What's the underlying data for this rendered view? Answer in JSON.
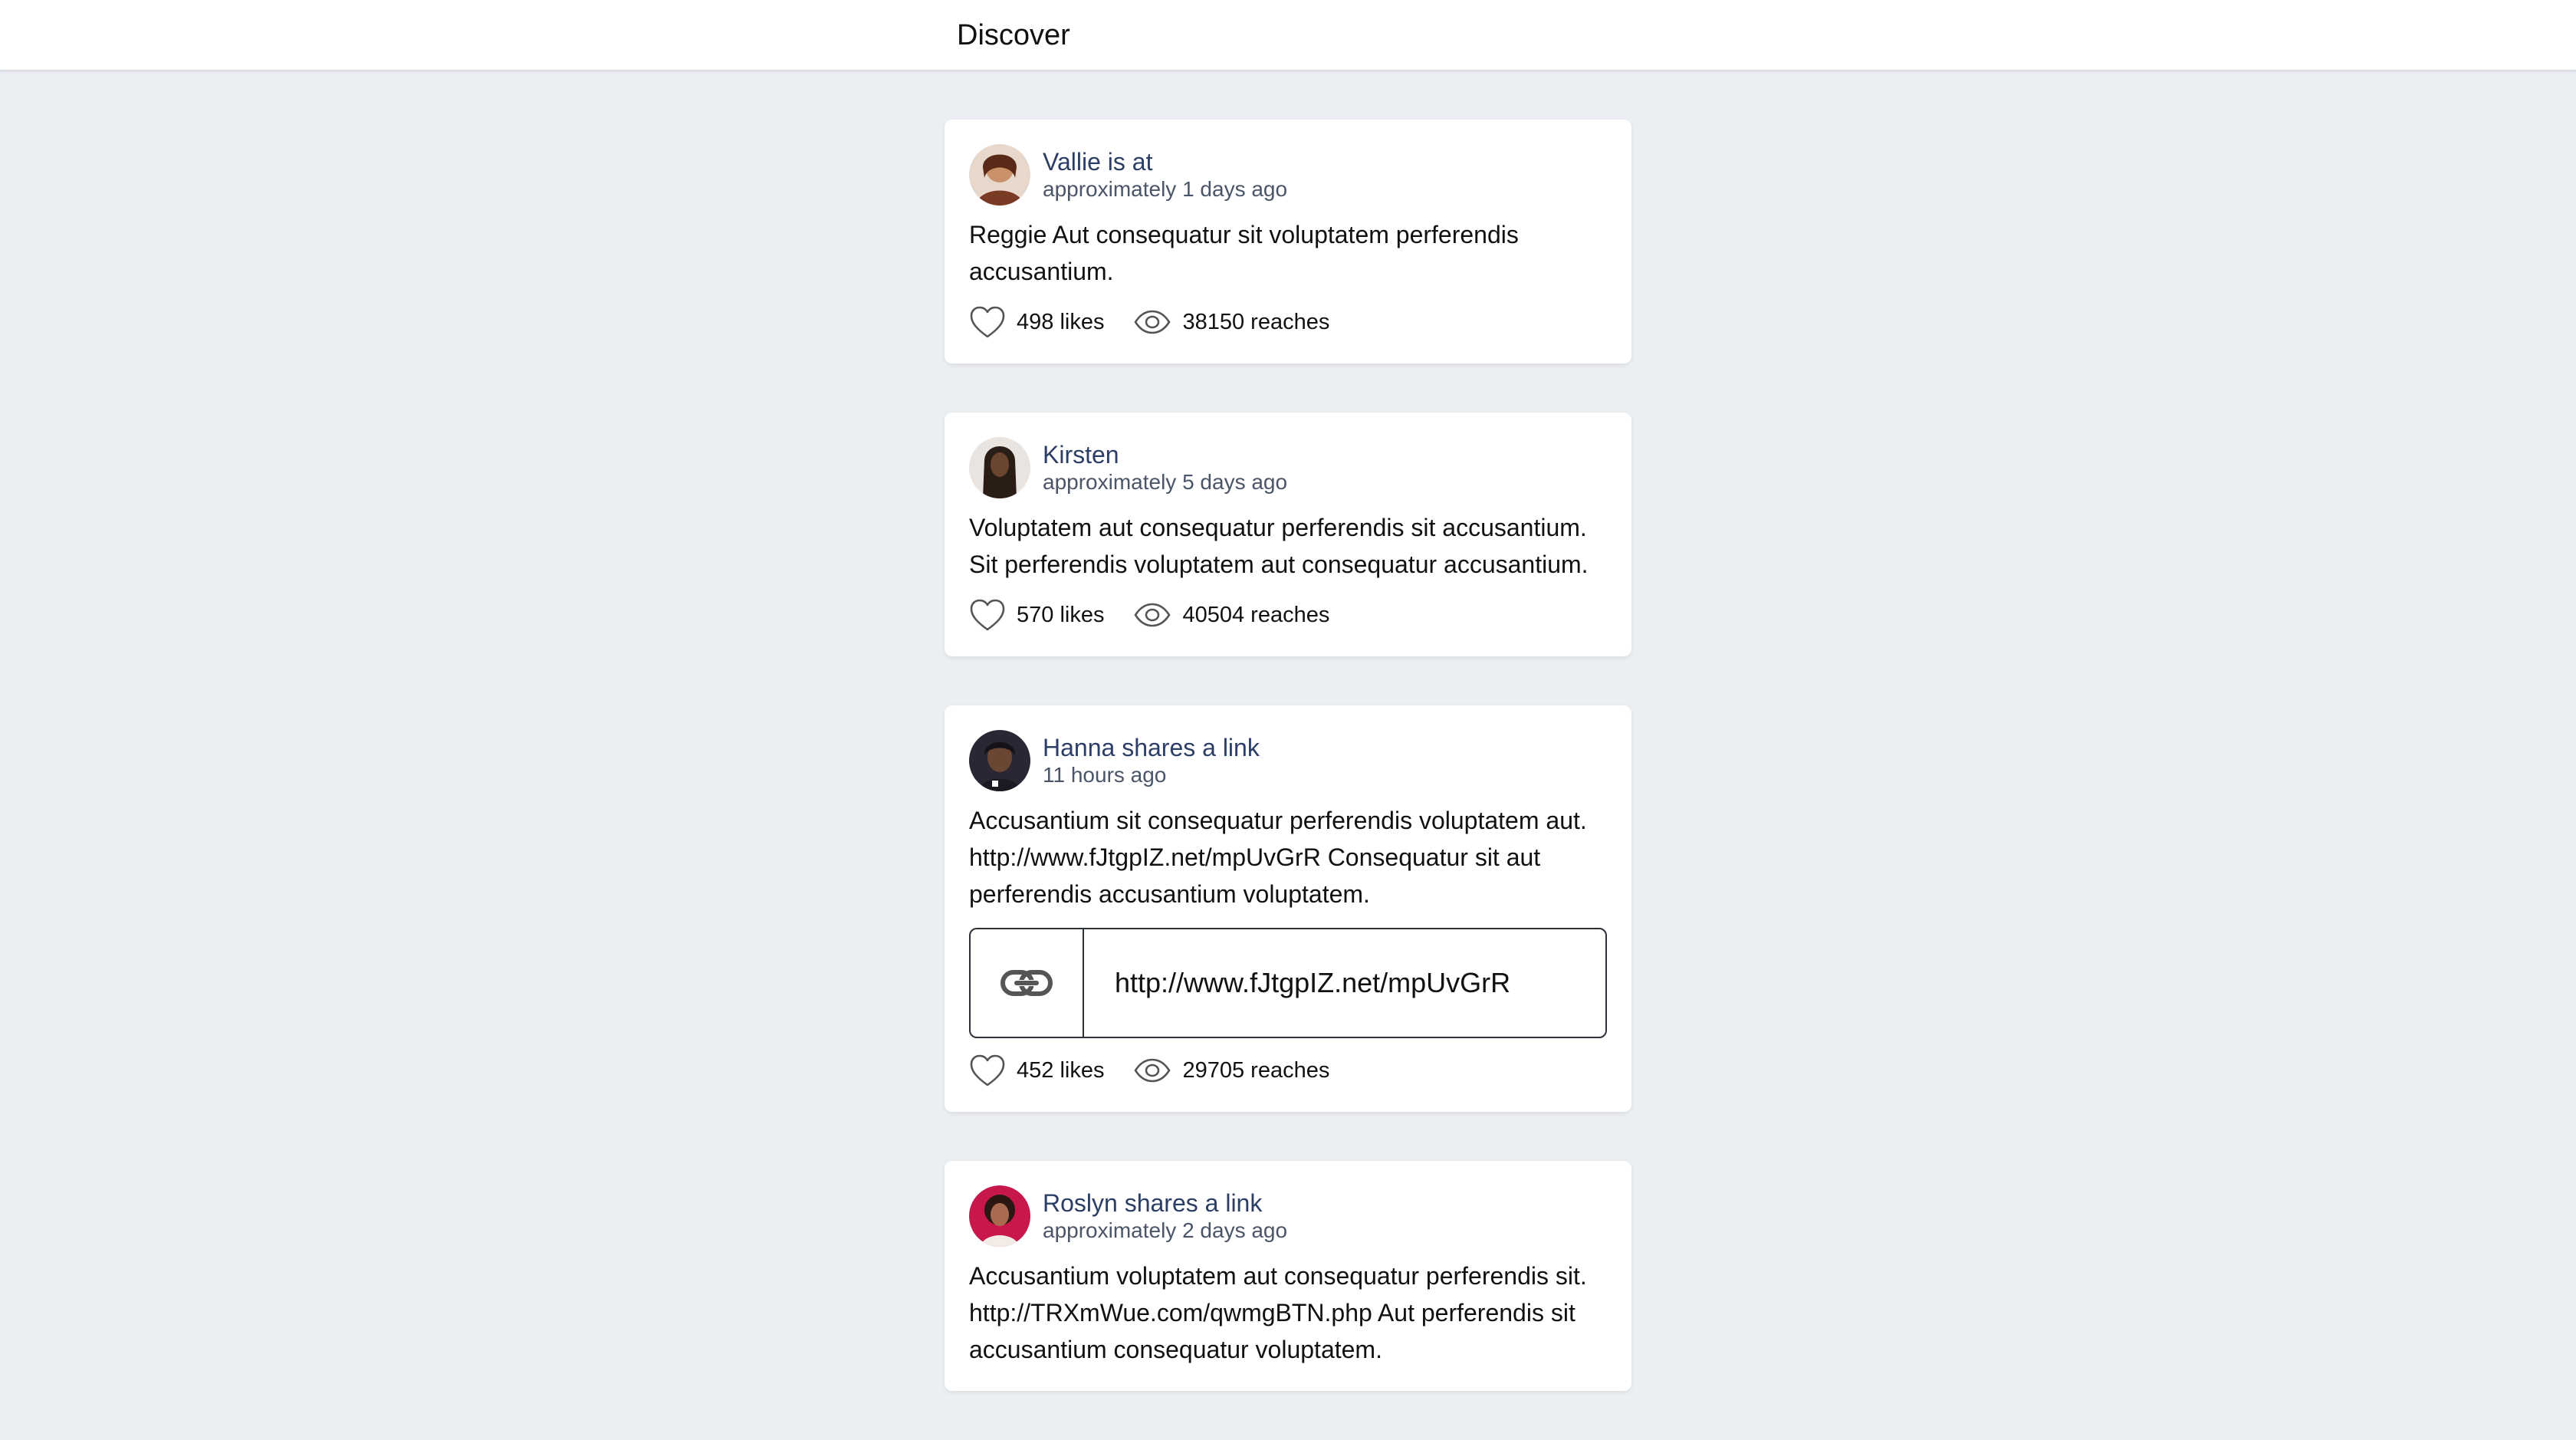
{
  "header": {
    "title": "Discover"
  },
  "posts": [
    {
      "author": "Vallie is at",
      "time": "approximately 1 days ago",
      "text": "Reggie Aut consequatur sit voluptatem perferendis accusantium.",
      "likes": "498 likes",
      "reaches": "38150 reaches",
      "avatar_colors": [
        "#c9906a",
        "#7a3b24"
      ]
    },
    {
      "author": "Kirsten",
      "time": "approximately 5 days ago",
      "text": "Voluptatem aut consequatur perferendis sit accusantium. Sit perferendis voluptatem aut consequatur accusantium.",
      "likes": "570 likes",
      "reaches": "40504 reaches",
      "avatar_colors": [
        "#e9e4df",
        "#2a1d16"
      ]
    },
    {
      "author": "Hanna shares a link",
      "time": "11 hours ago",
      "text": "Accusantium sit consequatur perferendis voluptatem aut. http://www.fJtgpIZ.net/mpUvGrR Consequatur sit aut perferendis accusantium voluptatem.",
      "link_url": "http://www.fJtgpIZ.net/mpUvGrR",
      "likes": "452 likes",
      "reaches": "29705 reaches",
      "avatar_colors": [
        "#2a2633",
        "#6b4633"
      ]
    },
    {
      "author": "Roslyn shares a link",
      "time": "approximately 2 days ago",
      "text": "Accusantium voluptatem aut consequatur perferendis sit. http://TRXmWue.com/qwmgBTN.php Aut perferendis sit accusantium consequatur voluptatem.",
      "avatar_colors": [
        "#c8174a",
        "#5a3628"
      ]
    }
  ],
  "icons": {
    "like": "heart-icon",
    "reach": "eye-icon",
    "link": "link-icon"
  }
}
